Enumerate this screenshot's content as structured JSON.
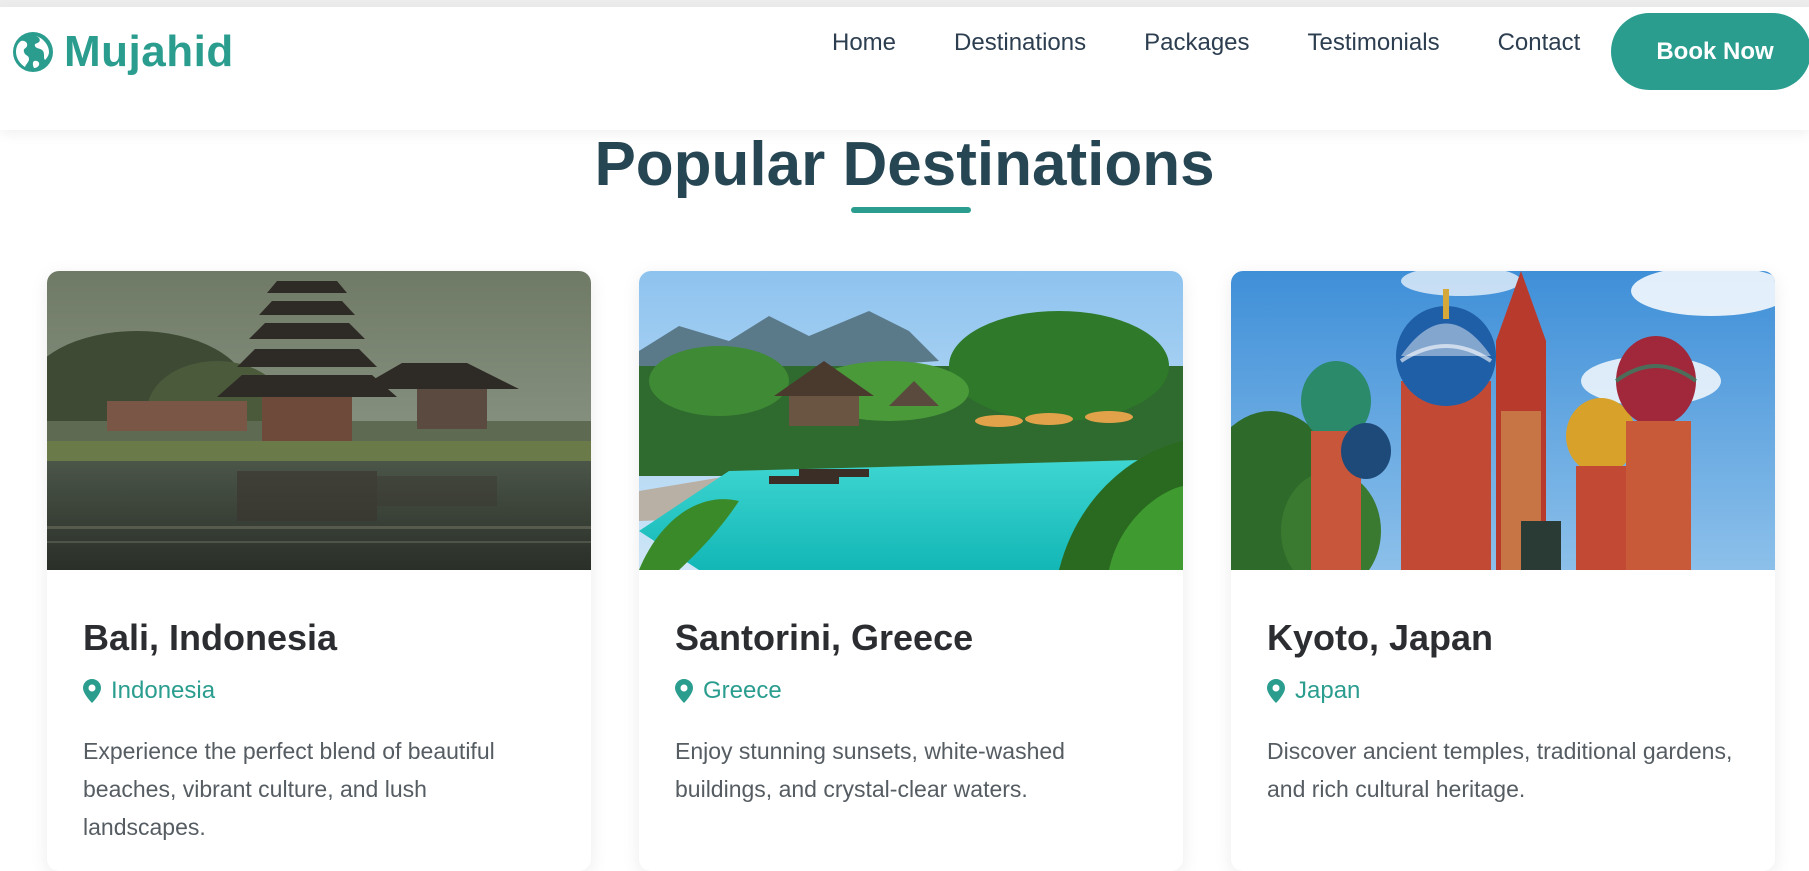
{
  "brand": {
    "name": "Mujahid",
    "icon": "globe-icon",
    "color": "#2a9d8f"
  },
  "nav": {
    "links": [
      {
        "label": "Home"
      },
      {
        "label": "Destinations"
      },
      {
        "label": "Packages"
      },
      {
        "label": "Testimonials"
      },
      {
        "label": "Contact"
      }
    ],
    "cta_label": "Book Now"
  },
  "section": {
    "title": "Popular Destinations",
    "accent_color": "#2a9d8f"
  },
  "destinations": [
    {
      "title": "Bali, Indonesia",
      "location": "Indonesia",
      "location_icon": "map-pin-icon",
      "description": "Experience the perfect blend of beautiful beaches, vibrant culture, and lush landscapes.",
      "image": "bali-temple-lake-photo"
    },
    {
      "title": "Santorini, Greece",
      "location": "Greece",
      "location_icon": "map-pin-icon",
      "description": "Enjoy stunning sunsets, white-washed buildings, and crystal-clear waters.",
      "image": "tropical-resort-pool-photo"
    },
    {
      "title": "Kyoto, Japan",
      "location": "Japan",
      "location_icon": "map-pin-icon",
      "description": "Discover ancient temples, traditional gardens, and rich cultural heritage.",
      "image": "st-basils-cathedral-photo"
    }
  ]
}
